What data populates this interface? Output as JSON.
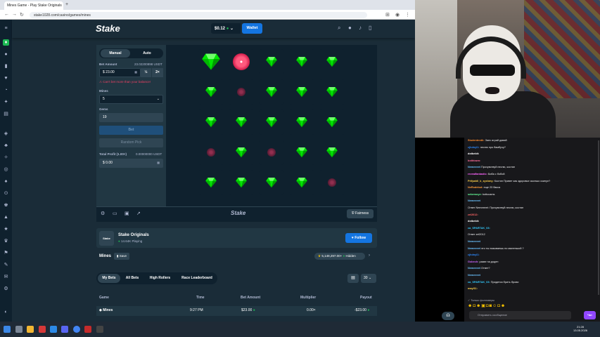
{
  "browser": {
    "tab_title": "Mines Game - Play Stake Originals",
    "new_tab": "+",
    "url": "stake1028.com/casino/games/mines"
  },
  "topbar": {
    "logo": "Stake",
    "balance": "$0.12",
    "wallet_label": "Wallet"
  },
  "controls": {
    "manual_label": "Manual",
    "auto_label": "Auto",
    "bet_amount_label": "Bet Amount",
    "bet_amount_usdt": "23.02200898 USDT",
    "bet_amount_value": "$ 23.00",
    "half_label": "½",
    "double_label": "2×",
    "warning": "Can't bet more than your balance!",
    "mines_label": "Mines",
    "mines_value": "5",
    "gems_label": "Gems",
    "gems_value": "19",
    "bet_button": "Bet",
    "random_pick_button": "Random Pick",
    "total_profit_label": "Total Profit (1.00×)",
    "total_profit_usdt": "0.00000000 USDT",
    "total_profit_value": "$ 0.00"
  },
  "game": {
    "board": [
      [
        "gem-big",
        "mine-big",
        "gem",
        "gem",
        "gem"
      ],
      [
        "gem",
        "mine",
        "gem",
        "gem",
        "gem"
      ],
      [
        "gem",
        "gem",
        "gem",
        "gem",
        "gem"
      ],
      [
        "mine",
        "gem",
        "mine",
        "gem",
        "gem"
      ],
      [
        "gem",
        "gem",
        "gem",
        "gem",
        "mine"
      ]
    ],
    "footer_logo": "Stake",
    "fairness_label": "Fairness"
  },
  "originals": {
    "avatar_text": "Stake",
    "name": "Stake Originals",
    "playing": "14.64K Playing",
    "follow_label": "Follow"
  },
  "mines_row": {
    "title": "Mines",
    "save_label": "Save",
    "total_bets": "5,148,297.00+",
    "hidden_label": "Hidden"
  },
  "bets": {
    "tabs": [
      "My Bets",
      "All Bets",
      "High Rollers",
      "Race Leaderboard"
    ],
    "count": "30",
    "columns": [
      "Game",
      "Time",
      "Bet Amount",
      "Multiplier",
      "Payout"
    ],
    "rows": [
      {
        "game": "Mines",
        "time": "9:27 PM",
        "bet": "$23.00",
        "multiplier": "0.00×",
        "payout": "-$23.00"
      }
    ]
  },
  "chat": {
    "messages": [
      {
        "user": "Studentnnth:",
        "text": "Заес играй давай",
        "color": "#ff8c2e"
      },
      {
        "user": "cjhdnyl1:",
        "text": "песню про бамбучу?",
        "color": "#2e8bff"
      },
      {
        "user": "dotbebit:",
        "text": "",
        "color": "#ffffff"
      },
      {
        "user": "bothtown:",
        "text": "",
        "color": "#ff6b9a"
      },
      {
        "user": "Nemeeeet",
        "text": "Прочувствуй песню, костян",
        "color": "#6bc3ff"
      },
      {
        "user": "revealfantastic:",
        "text": "Биба с бобой",
        "color": "#ff66ff"
      },
      {
        "user": "Prifpahll_k_zyshmy:",
        "text": "Костян Привет как здоровье сколько скинул?",
        "color": "#ffd24a"
      },
      {
        "user": "NeRodebot:",
        "text": "еще 23 бакса",
        "color": "#ff9c3a"
      },
      {
        "user": "sebemoye:",
        "text": "bottocams",
        "color": "#66ff99"
      },
      {
        "user": "Nemeeeet",
        "text": "",
        "color": "#6bc3ff"
      },
      {
        "user": "",
        "text": "Ответ Nemeeeet: Прочувствуй песню, костян",
        "color": "#adadb8"
      },
      {
        "user": "zel2012:",
        "text": "",
        "color": "#ff6666"
      },
      {
        "user": "dotbebit:",
        "text": "",
        "color": "#ffffff"
      },
      {
        "user": "ca_SPARTAK_03:",
        "text": "",
        "color": "#33ccff"
      },
      {
        "user": "",
        "text": "Ответ zel2012",
        "color": "#adadb8"
      },
      {
        "user": "Nemeeeet",
        "text": "",
        "color": "#6bc3ff"
      },
      {
        "user": "Nemeeeet",
        "text": "это ты называешь по маленькой ?",
        "color": "#6bc3ff"
      },
      {
        "user": "cjhdnyl1:",
        "text": "",
        "color": "#2e8bff"
      },
      {
        "user": "Gobech:",
        "text": "разве на додеп",
        "color": "#cc66ff"
      },
      {
        "user": "Nemeeeet",
        "text": "Ответ?",
        "color": "#6bc3ff"
      },
      {
        "user": "Nemeeeet",
        "text": "",
        "color": "#6bc3ff"
      },
      {
        "user": "ca_SPARTAK_03:",
        "text": "Придется брить брови",
        "color": "#33ccff"
      },
      {
        "user": "mayl11:",
        "text": "",
        "color": "#ffd24a"
      }
    ],
    "followers_only": "Только фолловеры",
    "input_placeholder": "Отправить сообщение",
    "send_label": "Чат"
  },
  "taskbar": {
    "time": "21:28",
    "date": "13.05.2026"
  },
  "colors": {
    "accent": "#1475e1",
    "gem": "#00e701",
    "mine": "#ed4163",
    "twitch": "#9147ff"
  }
}
